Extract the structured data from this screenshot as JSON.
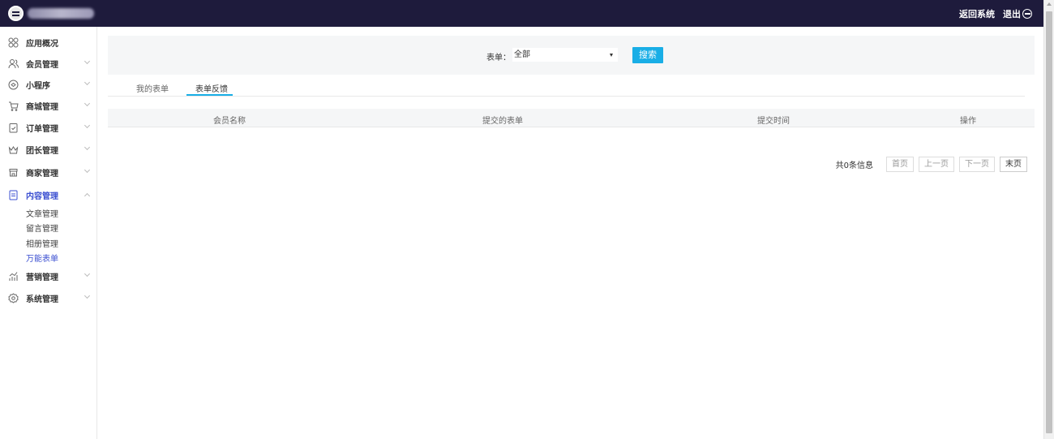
{
  "header": {
    "return_label": "返回系统",
    "logout_label": "退出"
  },
  "sidebar": {
    "items": [
      {
        "label": "应用概况",
        "icon": "grid-icon"
      },
      {
        "label": "会员管理",
        "icon": "users-icon"
      },
      {
        "label": "小程序",
        "icon": "miniapp-icon"
      },
      {
        "label": "商城管理",
        "icon": "cart-icon"
      },
      {
        "label": "订单管理",
        "icon": "order-icon"
      },
      {
        "label": "团长管理",
        "icon": "crown-icon"
      },
      {
        "label": "商家管理",
        "icon": "store-icon"
      },
      {
        "label": "内容管理",
        "icon": "document-icon"
      },
      {
        "label": "营销管理",
        "icon": "chart-icon"
      },
      {
        "label": "系统管理",
        "icon": "settings-icon"
      }
    ],
    "content_sub": [
      "文章管理",
      "留言管理",
      "相册管理",
      "万能表单"
    ]
  },
  "filter": {
    "label": "表单：",
    "selected": "全部",
    "search_label": "搜索"
  },
  "tabs": [
    "我的表单",
    "表单反馈"
  ],
  "table": {
    "headers": [
      "会员名称",
      "提交的表单",
      "提交时间",
      "操作"
    ]
  },
  "pager": {
    "total": "共0条信息",
    "first": "首页",
    "prev": "上一页",
    "next": "下一页",
    "last": "末页"
  },
  "colors": {
    "topbar": "#1e1b3c",
    "accent": "#19aee6",
    "active_menu": "#3b4fd1"
  }
}
